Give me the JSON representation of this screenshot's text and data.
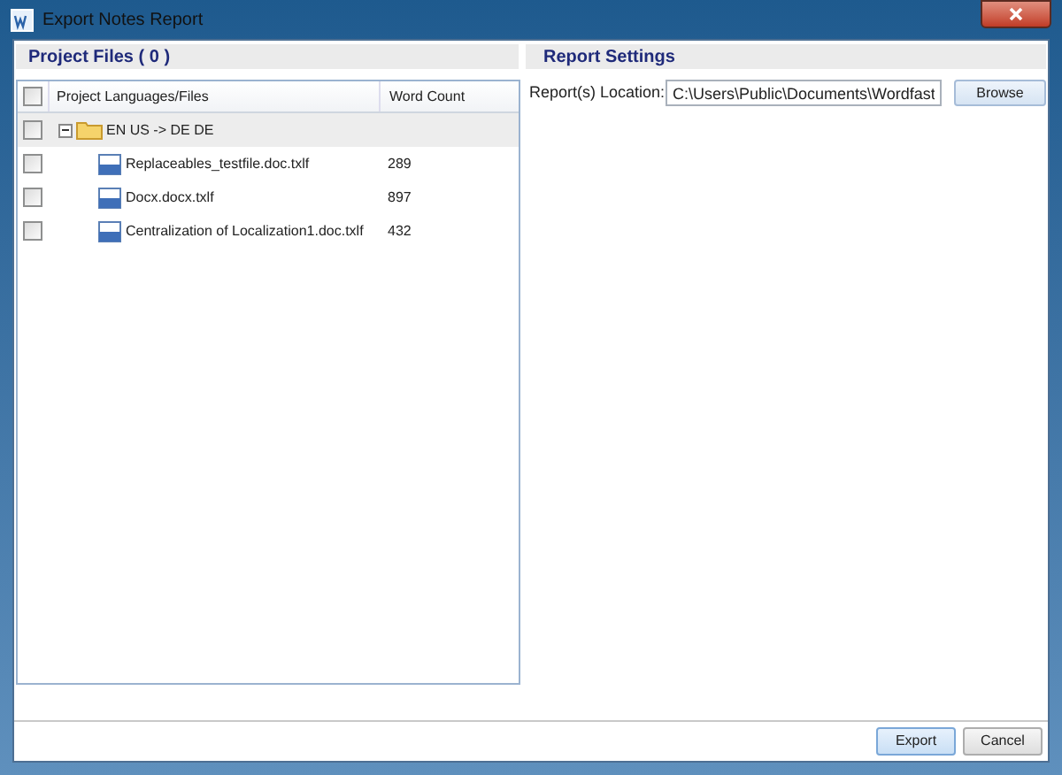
{
  "window": {
    "title": "Export Notes Report"
  },
  "project_files": {
    "title": "Project Files ( 0 )",
    "columns": [
      "Project Languages/Files",
      "Word Count"
    ],
    "header_checked": false,
    "tree": [
      {
        "label": "EN US -> DE DE",
        "checked": false,
        "expanded": true,
        "children": [
          {
            "label": "Replaceables_testfile.doc.txlf",
            "word_count": "289",
            "checked": false
          },
          {
            "label": "Docx.docx.txlf",
            "word_count": "897",
            "checked": false
          },
          {
            "label": "Centralization of Localization1.doc.txlf",
            "word_count": "432",
            "checked": false
          }
        ]
      }
    ]
  },
  "report_settings": {
    "title": "Report Settings",
    "location_label": "Report(s) Location:",
    "location_value": "C:\\Users\\Public\\Documents\\Wordfast",
    "browse": "Browse"
  },
  "buttons": [
    {
      "label": "Export",
      "kind": "primary"
    },
    {
      "label": "Cancel",
      "kind": "normal"
    }
  ]
}
